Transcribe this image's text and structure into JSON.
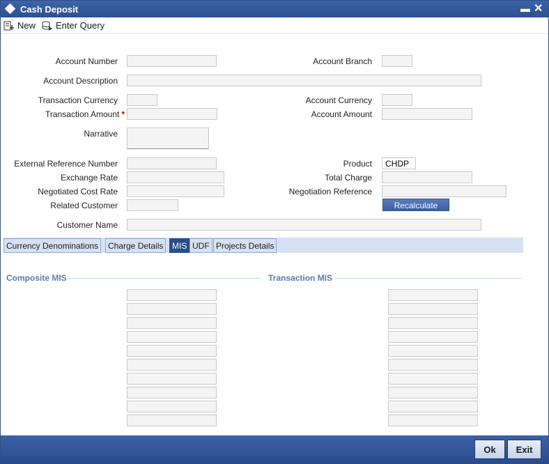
{
  "window": {
    "title": "Cash Deposit",
    "minimize_glyph": "▬",
    "close_glyph": "✕"
  },
  "toolbar": {
    "new_label": "New",
    "enter_query_label": "Enter Query"
  },
  "form": {
    "account_number_label": "Account Number",
    "account_branch_label": "Account Branch",
    "account_description_label": "Account Description",
    "transaction_currency_label": "Transaction Currency",
    "account_currency_label": "Account Currency",
    "transaction_amount_label": "Transaction Amount",
    "required_mark": "*",
    "account_amount_label": "Account Amount",
    "narrative_label": "Narrative",
    "external_reference_label": "External Reference Number",
    "product_label": "Product",
    "product_value": "CHDP",
    "exchange_rate_label": "Exchange Rate",
    "total_charge_label": "Total Charge",
    "negotiated_cost_rate_label": "Negotiated Cost Rate",
    "negotiation_reference_label": "Negotiation Reference",
    "related_customer_label": "Related Customer",
    "recalculate_label": "Recalculate",
    "customer_name_label": "Customer Name"
  },
  "tabs": [
    {
      "label": "Currency Denominations",
      "active": false
    },
    {
      "label": "Charge Details",
      "active": false
    },
    {
      "label": "MIS",
      "active": true
    },
    {
      "label": "UDF",
      "active": false
    },
    {
      "label": "Projects Details",
      "active": false
    }
  ],
  "mis": {
    "composite_title": "Composite MIS",
    "transaction_title": "Transaction MIS",
    "composite_field_count": 10,
    "transaction_field_count": 10
  },
  "footer": {
    "ok_label": "Ok",
    "exit_label": "Exit"
  }
}
